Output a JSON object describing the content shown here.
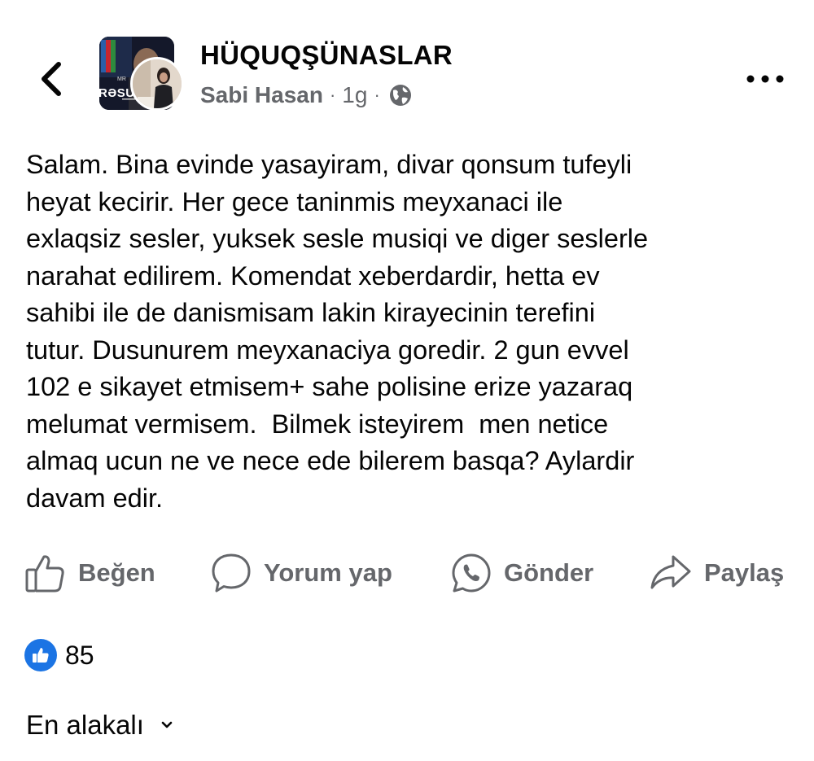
{
  "header": {
    "group_name": "HÜQUQŞÜNASLAR",
    "author": "Sabi Hasan",
    "separator": "·",
    "time_ago": "1g",
    "group_avatar_text": "RƏSU",
    "group_avatar_small_text": "MR",
    "privacy_icon": "globe-icon",
    "back_icon": "chevron-left-icon",
    "more_icon": "more-horizontal-icon"
  },
  "post": {
    "text": "Salam. Bina evinde yasayiram, divar qonsum tufeyli\nheyat kecirir. Her gece taninmis meyxanaci ile\nexlaqsiz sesler, yuksek sesle musiqi ve diger seslerle\nnarahat edilirem. Komendat xeberdardir, hetta ev\nsahibi ile de danismisam lakin kirayecinin terefini\ntutur. Dusunurem meyxanaciya goredir. 2 gun evvel\n102 e sikayet etmisem+ sahe polisine erize yazaraq\nmelumat vermisem.  Bilmek isteyirem  men netice\nalmaq ucun ne ve nece ede bilerem basqa? Aylardir\ndavam edir."
  },
  "actions": {
    "like": {
      "label": "Beğen",
      "icon": "thumbs-up-icon"
    },
    "comment": {
      "label": "Yorum yap",
      "icon": "comment-icon"
    },
    "send": {
      "label": "Gönder",
      "icon": "whatsapp-icon"
    },
    "share": {
      "label": "Paylaş",
      "icon": "share-icon"
    }
  },
  "reactions": {
    "count": "85",
    "icon": "like-reaction-icon"
  },
  "comments": {
    "sort_label": "En alakalı",
    "sort_icon": "chevron-down-icon"
  },
  "colors": {
    "text_primary": "#050505",
    "text_secondary": "#65676b",
    "like_blue": "#1b74e4"
  }
}
